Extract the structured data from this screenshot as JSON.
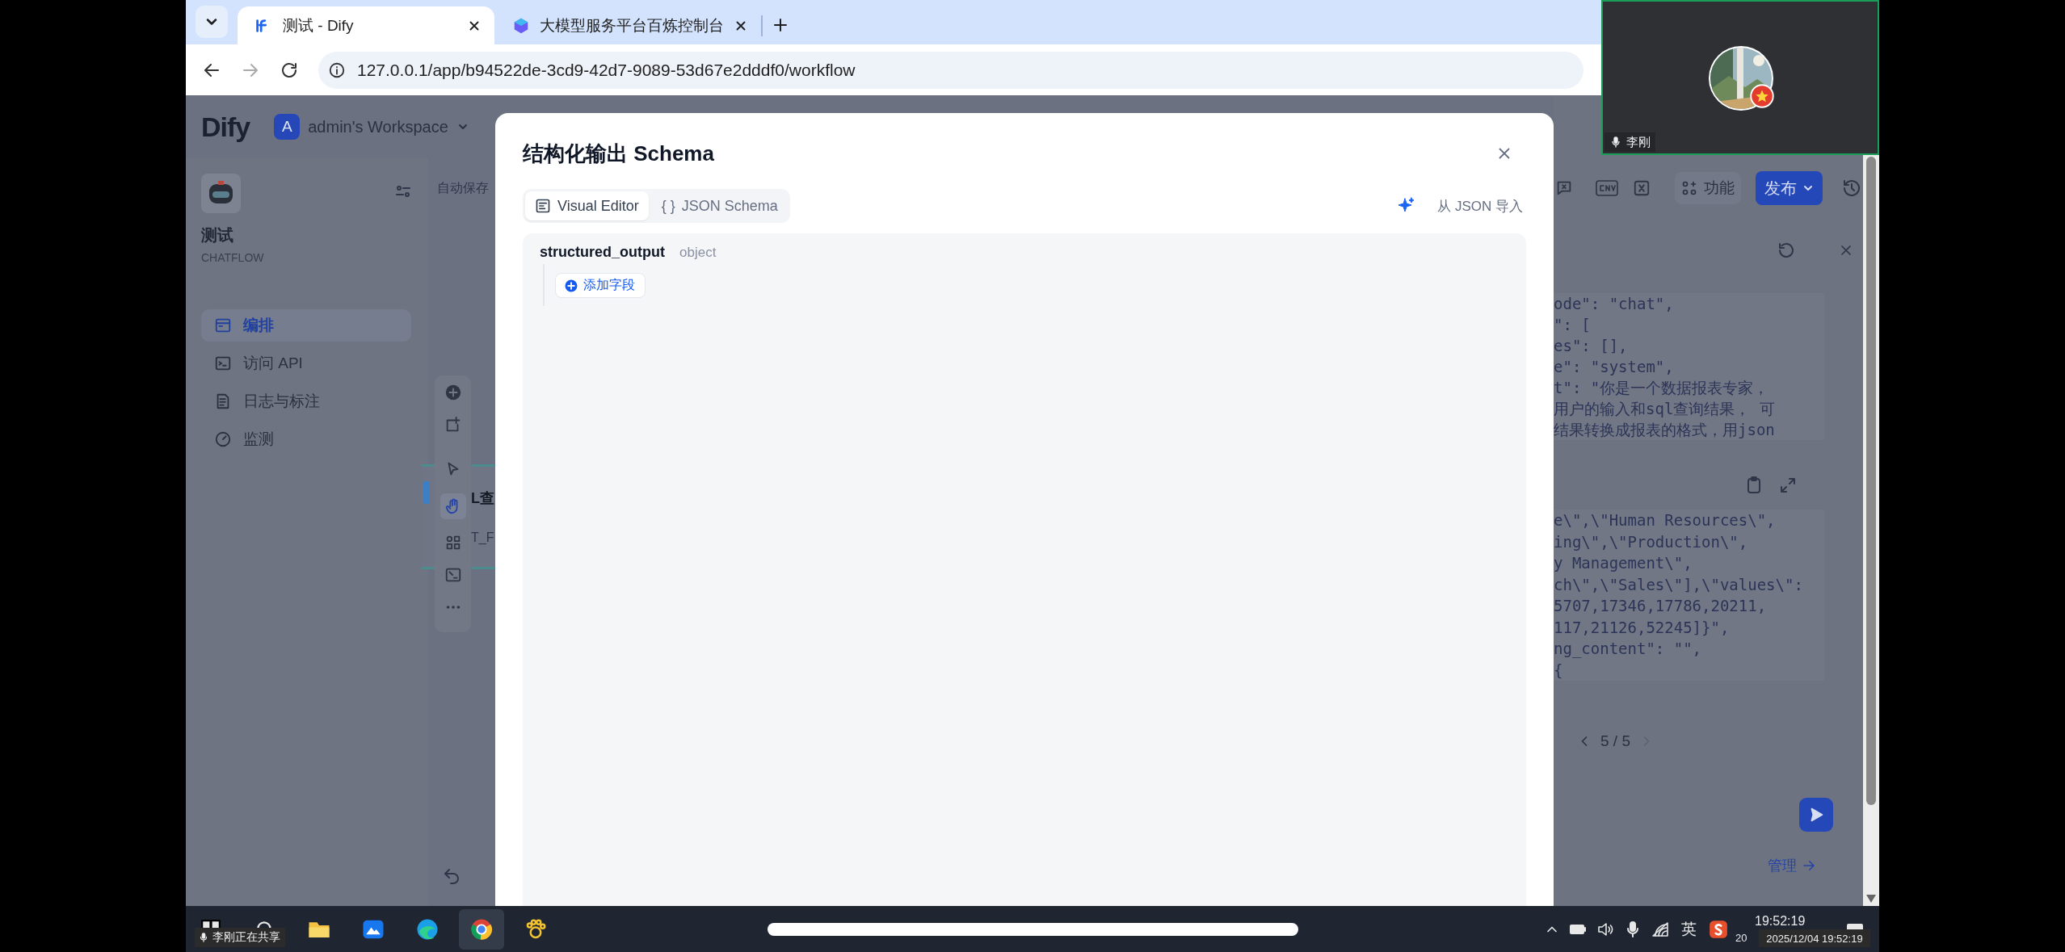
{
  "browser": {
    "tabs": [
      {
        "title": "测试 - Dify",
        "selected": true,
        "kind": "dify"
      },
      {
        "title": "大模型服务平台百炼控制台",
        "selected": false,
        "kind": "cube"
      }
    ],
    "url": "127.0.0.1/app/b94522de-3cd9-42d7-9089-53d67e2dddf0/workflow"
  },
  "app_header": {
    "logo": "Dify",
    "workspace_initial": "A",
    "workspace": "admin's Workspace"
  },
  "sidebar": {
    "app_name": "测试",
    "app_type": "CHATFLOW",
    "items": [
      {
        "label": "编排",
        "selected": true,
        "kind": "orchestrate"
      },
      {
        "label": "访问 API",
        "selected": false,
        "kind": "api"
      },
      {
        "label": "日志与标注",
        "selected": false,
        "kind": "logs"
      },
      {
        "label": "监测",
        "selected": false,
        "kind": "monitor"
      }
    ]
  },
  "canvas": {
    "save_status": "自动保存",
    "node_title": "L查",
    "node_subtitle": "T_F"
  },
  "right_panel": {
    "features": "功能",
    "publish": "发布",
    "code_lines": [
      "ode\": \"chat\",",
      "\": [",
      "es\": [],",
      "e\": \"system\",",
      "t\": \"你是一个数据报表专家，",
      "用户的输入和sql查询结果， 可",
      "结果转换成报表的格式，用json"
    ],
    "code_lines_2": [
      "e\\\",\\\"Human Resources\\\",",
      "ing\\\",\\\"Production\\\",",
      "y Management\\\",",
      "ch\\\",\\\"Sales\\\"],\\\"values\\\":",
      "5707,17346,17786,20211,",
      "117,21126,52245]}\",",
      "ng_content\": \"\",",
      "{"
    ],
    "pager": "5 / 5",
    "manage": "管理"
  },
  "modal": {
    "title": "结构化输出 Schema",
    "tabs": [
      {
        "label": "Visual Editor",
        "selected": true,
        "kind": "visual"
      },
      {
        "label": "JSON Schema",
        "selected": false,
        "kind": "json",
        "icon_text": "{ }"
      }
    ],
    "import": "从 JSON 导入",
    "field_name": "structured_output",
    "field_type": "object",
    "add_field": "添加字段"
  },
  "meeting": {
    "participant": "李刚",
    "sharing_notice": "李刚正在共享"
  },
  "taskbar": {
    "input_method": "英",
    "time": "19:52:19",
    "date": "20",
    "timestamp_overlay": "2025/12/04 19:52:19"
  }
}
